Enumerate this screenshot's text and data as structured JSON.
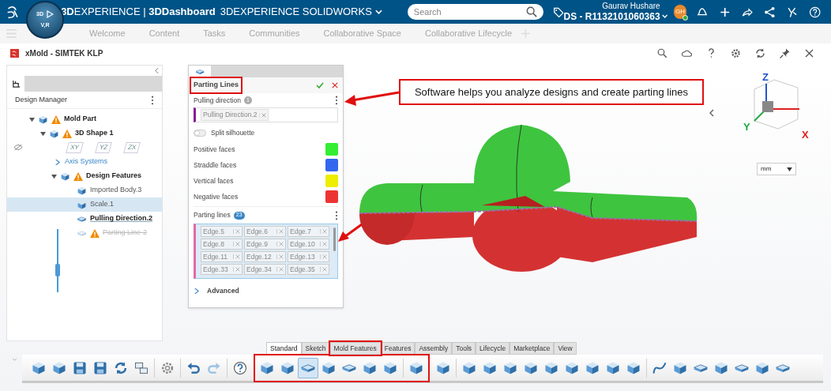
{
  "topbar": {
    "compass": {
      "top_label": "3D",
      "bottom_label": "V,R"
    },
    "brand": "**3D**EXPERIENCE | **3DDashboard**",
    "app": "3DEXPERIENCE SOLIDWORKS",
    "search": {
      "placeholder": "Search"
    },
    "user": "Gaurav Hushare",
    "tenant": "DS - R1132101060363",
    "avatar": "GH"
  },
  "nav_tabs": [
    "Welcome",
    "Content",
    "Tasks",
    "Communities",
    "Collaborative Space",
    "Collaborative Lifecycle"
  ],
  "app_title": "xMold - SIMTEK KLP",
  "design_manager": {
    "title": "Design Manager",
    "tree": [
      {
        "label": "Mold Part",
        "kind": "part",
        "warning": true,
        "expanded": true,
        "selected": false,
        "current": false,
        "disabled": false,
        "children": [
          {
            "label": "3D Shape 1",
            "kind": "shape",
            "warning": true,
            "expanded": true,
            "selected": false,
            "current": false,
            "disabled": false,
            "children": [
              {
                "kind": "planes",
                "planes": [
                  "XY",
                  "YZ",
                  "ZX"
                ]
              },
              {
                "label": "Axis Systems",
                "kind": "folder",
                "expanded": false
              },
              {
                "label": "Design Features",
                "kind": "features",
                "warning": true,
                "expanded": true,
                "selected": false,
                "current": false,
                "disabled": false,
                "children": [
                  {
                    "label": "Imported Body.3",
                    "kind": "body",
                    "warning": false,
                    "selected": false,
                    "current": false,
                    "disabled": false
                  },
                  {
                    "label": "Scale.1",
                    "kind": "scale",
                    "warning": false,
                    "selected": true,
                    "current": false,
                    "disabled": false
                  },
                  {
                    "label": "Pulling Direction.2",
                    "kind": "direction",
                    "warning": false,
                    "selected": false,
                    "current": true,
                    "disabled": false
                  },
                  {
                    "label": "Parting Line-2",
                    "kind": "line",
                    "warning": true,
                    "selected": false,
                    "current": false,
                    "disabled": true
                  }
                ]
              }
            ]
          }
        ]
      }
    ]
  },
  "dialog": {
    "title": "Parting Lines",
    "highlighted": true,
    "pulling_direction": {
      "label": "Pulling direction",
      "count": "1",
      "value": "Pulling Direction.2"
    },
    "split_silhouette": {
      "label": "Split silhouette",
      "on": false
    },
    "faces": [
      {
        "label": "Positive faces",
        "color": "#33ee33"
      },
      {
        "label": "Straddle faces",
        "color": "#3366ee"
      },
      {
        "label": "Vertical faces",
        "color": "#eeee00"
      },
      {
        "label": "Negative faces",
        "color": "#ee3333"
      }
    ],
    "parting_lines": {
      "label": "Parting lines",
      "count": "23",
      "edges": [
        "Edge.5",
        "Edge.6",
        "Edge.7",
        "Edge.8",
        "Edge.9",
        "Edge.10",
        "Edge.11",
        "Edge.12",
        "Edge.13",
        "Edge.33",
        "Edge.34",
        "Edge.35"
      ]
    },
    "advanced": {
      "label": "Advanced",
      "expanded": false
    }
  },
  "annotation": "Software helps you analyze designs and create parting lines",
  "axes": [
    {
      "label": "Z",
      "color": "#2255cc"
    },
    {
      "label": "Y",
      "color": "#22aa44"
    },
    {
      "label": "X",
      "color": "#dd2222"
    }
  ],
  "units": "mm",
  "ribbon_tabs": [
    {
      "label": "Standard",
      "selected": true,
      "highlighted": false
    },
    {
      "label": "Sketch",
      "selected": false,
      "highlighted": false
    },
    {
      "label": "Mold Features",
      "selected": false,
      "highlighted": true
    },
    {
      "label": "Features",
      "selected": false,
      "highlighted": false
    },
    {
      "label": "Assembly",
      "selected": false,
      "highlighted": false
    },
    {
      "label": "Tools",
      "selected": false,
      "highlighted": false
    },
    {
      "label": "Lifecycle",
      "selected": false,
      "highlighted": false
    },
    {
      "label": "Marketplace",
      "selected": false,
      "highlighted": false
    },
    {
      "label": "View",
      "selected": false,
      "highlighted": false
    }
  ],
  "toolbar": [
    {
      "highlighted": false,
      "groups": [
        [
          {
            "kind": "cube",
            "selected": false
          },
          {
            "kind": "cube",
            "selected": false
          },
          {
            "kind": "save",
            "selected": false
          },
          {
            "kind": "save",
            "selected": false
          },
          {
            "kind": "sync",
            "selected": false
          },
          {
            "kind": "swap",
            "selected": false
          }
        ],
        [
          {
            "kind": "gear",
            "selected": false
          }
        ],
        [
          {
            "kind": "undo",
            "selected": false
          },
          {
            "kind": "redo",
            "selected": false
          }
        ],
        [
          {
            "kind": "help",
            "selected": false
          }
        ]
      ]
    },
    {
      "highlighted": true,
      "groups": [
        [
          {
            "kind": "cube",
            "selected": false
          },
          {
            "kind": "cube",
            "selected": false
          },
          {
            "kind": "plate",
            "selected": true
          },
          {
            "kind": "cube",
            "selected": false
          },
          {
            "kind": "plate",
            "selected": false
          },
          {
            "kind": "cube",
            "selected": false
          },
          {
            "kind": "cube",
            "selected": false
          }
        ],
        [
          {
            "kind": "cube",
            "selected": false
          }
        ]
      ]
    },
    {
      "highlighted": false,
      "groups": [
        [
          {
            "kind": "cube",
            "selected": false
          }
        ],
        [
          {
            "kind": "cube",
            "selected": false
          },
          {
            "kind": "cube",
            "selected": false
          },
          {
            "kind": "cube",
            "selected": false
          },
          {
            "kind": "cube",
            "selected": false
          },
          {
            "kind": "cube",
            "selected": false
          },
          {
            "kind": "cube",
            "selected": false
          },
          {
            "kind": "cube",
            "selected": false
          },
          {
            "kind": "cube",
            "selected": false
          },
          {
            "kind": "cube",
            "selected": false
          }
        ],
        [
          {
            "kind": "curve",
            "selected": false
          },
          {
            "kind": "cube",
            "selected": false
          },
          {
            "kind": "plate",
            "selected": false
          },
          {
            "kind": "cube",
            "selected": false
          },
          {
            "kind": "plate",
            "selected": false
          },
          {
            "kind": "cube",
            "selected": false
          },
          {
            "kind": "plate",
            "selected": false
          }
        ]
      ]
    }
  ]
}
